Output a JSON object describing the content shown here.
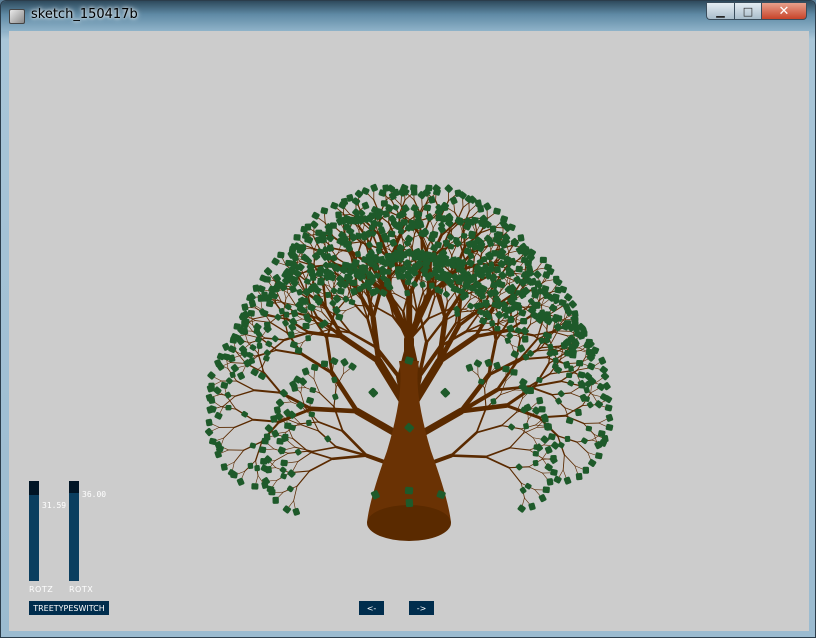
{
  "window": {
    "title": "sketch_150417b",
    "controls": {
      "minimize": "▁",
      "maximize": "□",
      "close": "✕"
    }
  },
  "colors": {
    "background": "#cccccc",
    "trunk": "#5a2a00",
    "leaf": "#1e5a2a",
    "control_bg": "#002d4d",
    "control_fg": "#0a4670",
    "control_active": "#00141f"
  },
  "controls": {
    "rotz": {
      "label": "ROTZ",
      "value_text": "31.59",
      "fraction": 0.86
    },
    "rotx": {
      "label": "ROTX",
      "value_text": "36.00",
      "fraction": 0.88
    },
    "treetype_button": "TREETYPESWITCH",
    "prev_button": "<-",
    "next_button": "->"
  }
}
